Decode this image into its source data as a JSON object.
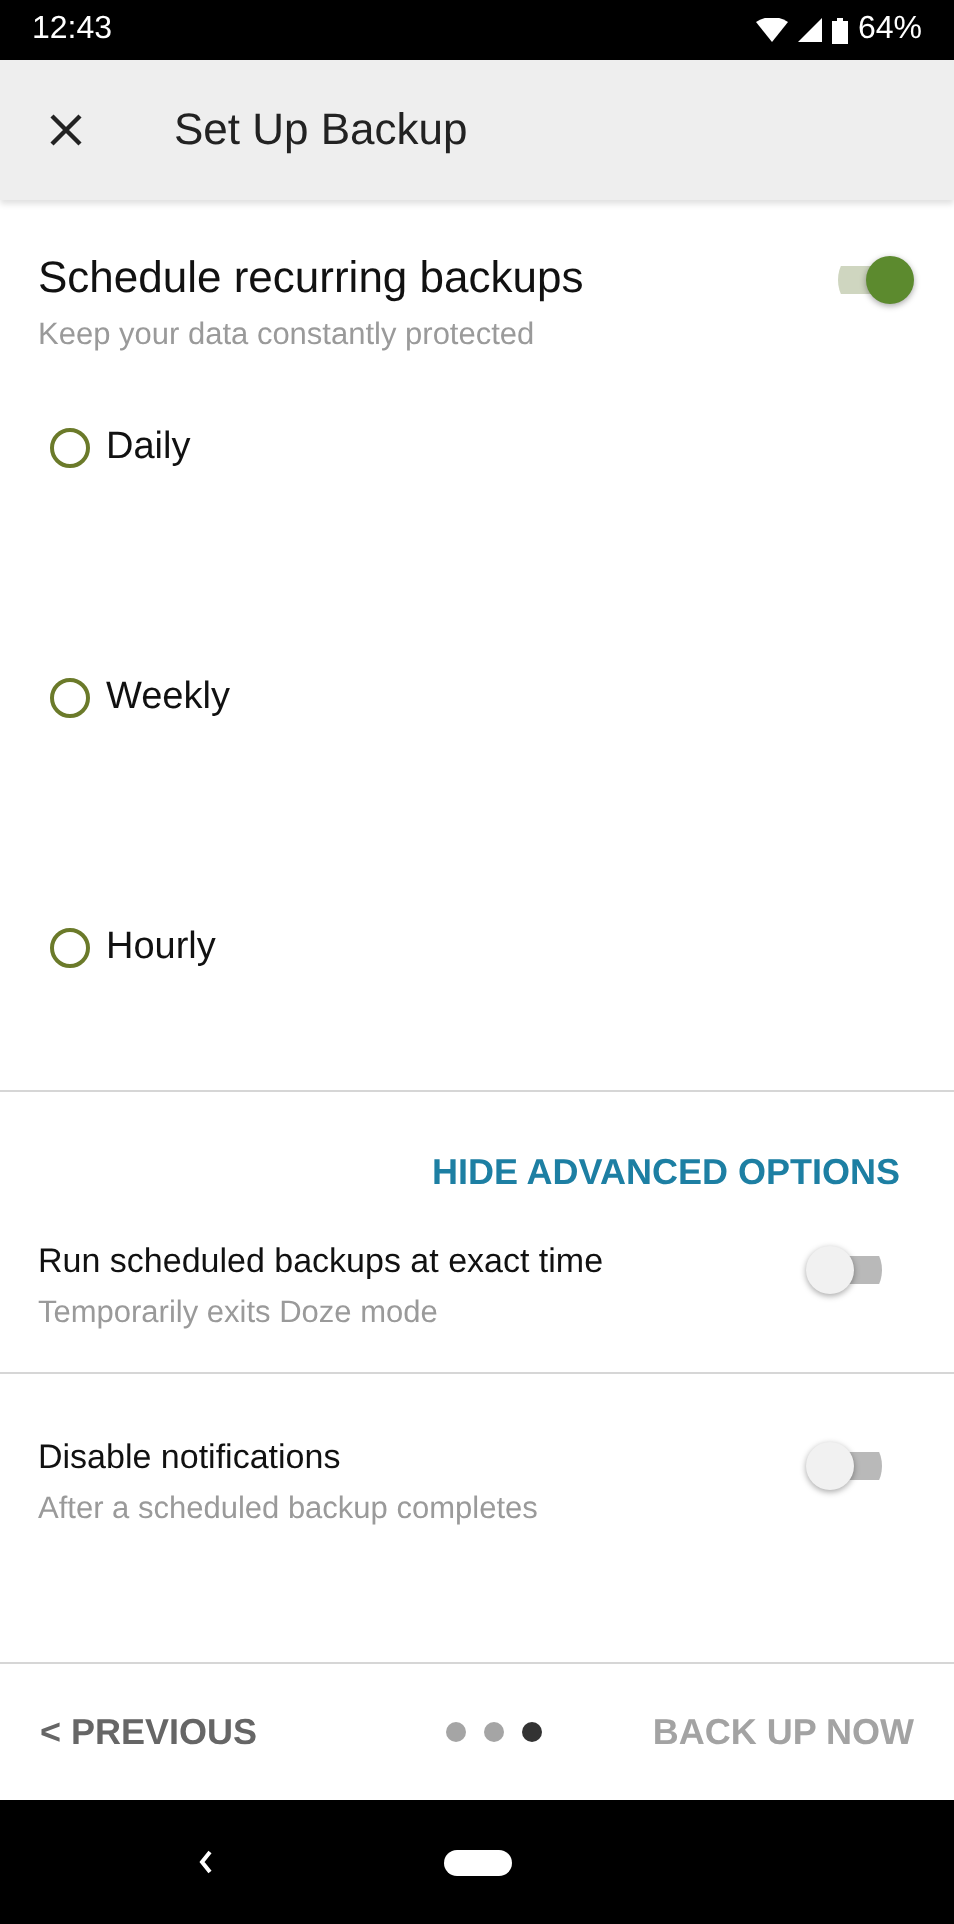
{
  "status_bar": {
    "time": "12:43",
    "battery": "64%"
  },
  "app_bar": {
    "title": "Set Up Backup"
  },
  "schedule": {
    "title": "Schedule recurring backups",
    "subtitle": "Keep your data constantly protected",
    "on": true
  },
  "frequencies": [
    {
      "label": "Daily",
      "selected": false
    },
    {
      "label": "Weekly",
      "selected": false
    },
    {
      "label": "Hourly",
      "selected": false
    }
  ],
  "advanced_link": "HIDE ADVANCED OPTIONS",
  "options": [
    {
      "title": "Run scheduled backups at exact time",
      "subtitle": "Temporarily exits Doze mode",
      "on": false
    },
    {
      "title": "Disable notifications",
      "subtitle": "After a scheduled backup completes",
      "on": false
    }
  ],
  "footer": {
    "previous": {
      "label": "< PREVIOUS",
      "disabled": false
    },
    "next": {
      "label": "BACK UP NOW",
      "disabled": true
    },
    "pages": [
      {
        "selected": false
      },
      {
        "selected": false
      },
      {
        "selected": true
      }
    ]
  }
}
